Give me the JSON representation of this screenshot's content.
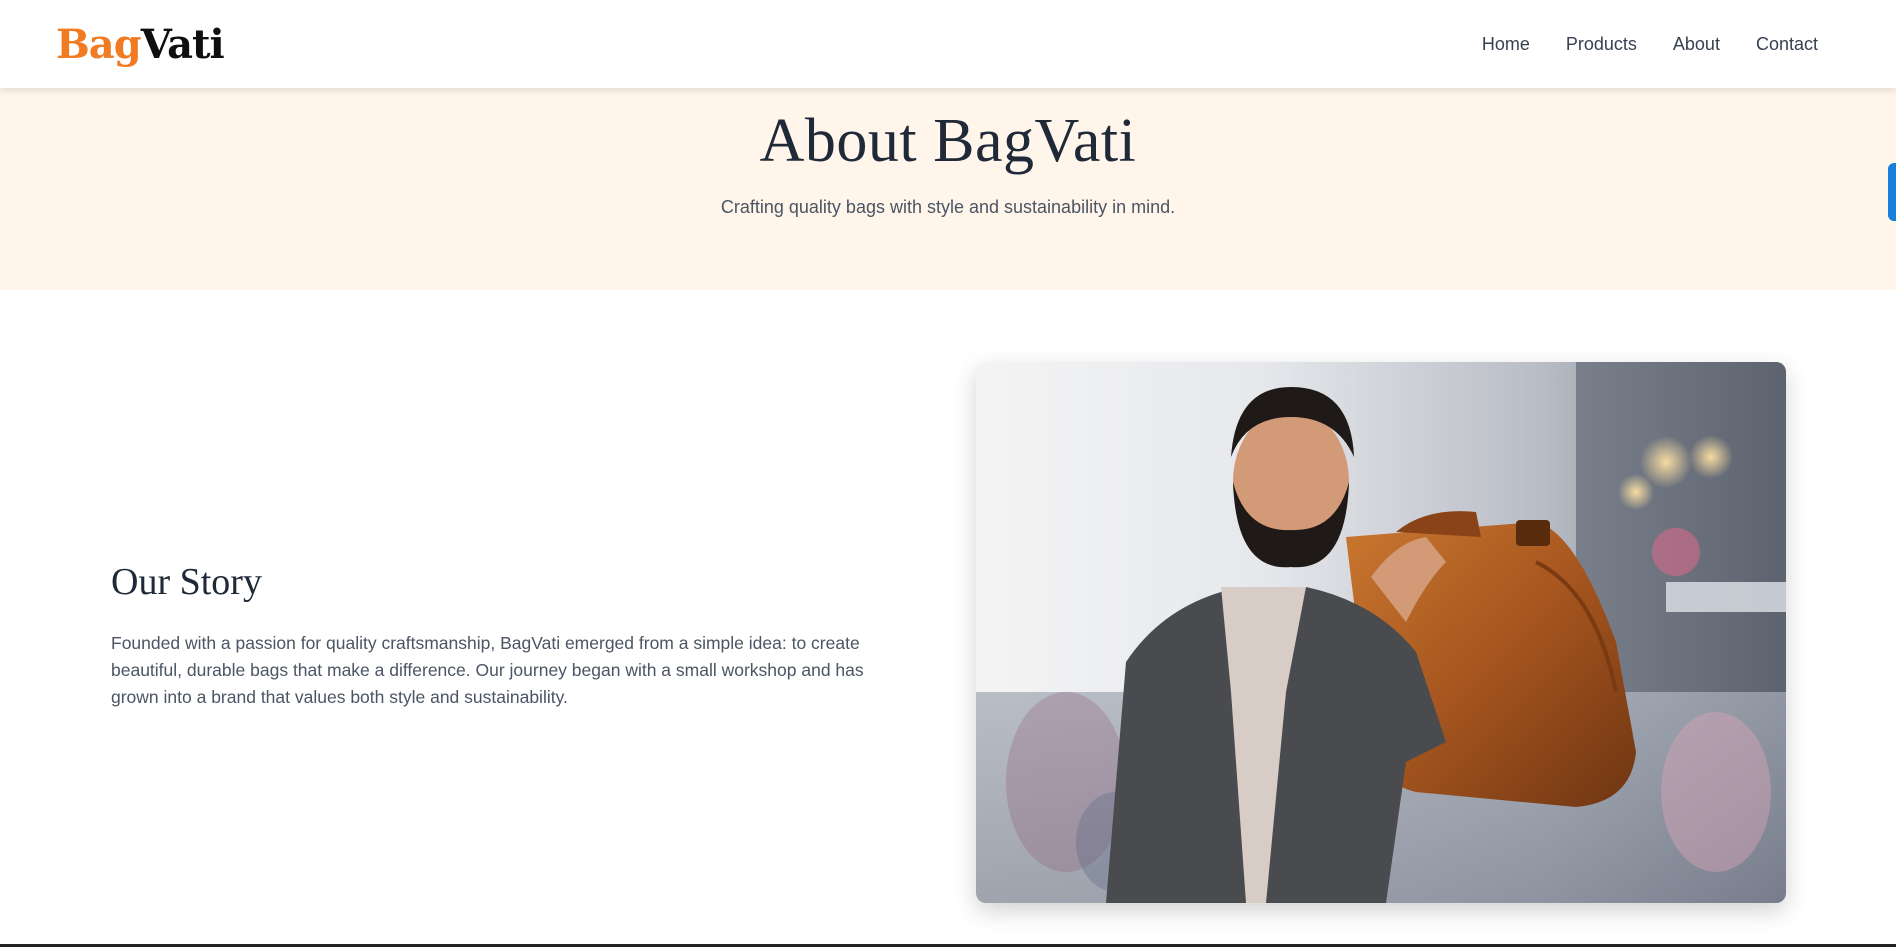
{
  "brand": {
    "part1": "Bag",
    "part2": "Vati"
  },
  "nav": {
    "items": [
      "Home",
      "Products",
      "About",
      "Contact"
    ]
  },
  "hero": {
    "title": "About BagVati",
    "subtitle": "Crafting quality bags with style and sustainability in mind."
  },
  "story": {
    "heading": "Our Story",
    "body": "Founded with a passion for quality craftsmanship, BagVati emerged from a simple idea: to create beautiful, durable bags that make a difference. Our journey began with a small workshop and has grown into a brand that values both style and sustainability."
  },
  "colors": {
    "brand_accent": "#f07b22",
    "hero_bg": "#fff5eb",
    "side_tab": "#1a7fdc"
  },
  "image": {
    "subject": "man-with-leather-suitcase-photo"
  }
}
